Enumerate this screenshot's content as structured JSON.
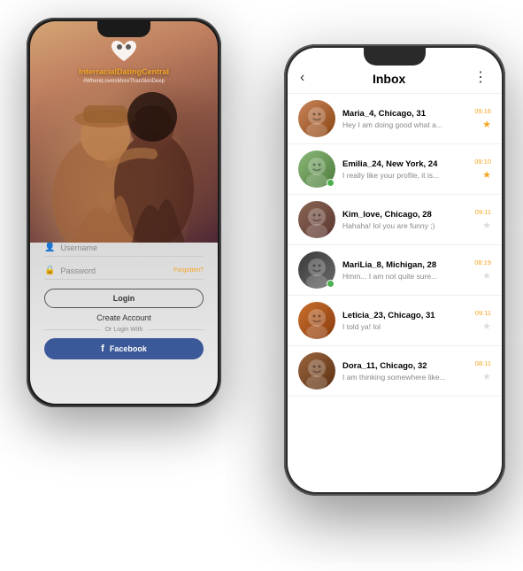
{
  "brand": {
    "logo_label": "InterracialDatingCentral",
    "logo_part1": "Interracial",
    "logo_part2": "Dating",
    "logo_part3": "Central",
    "tagline": "#WhereLoveIsMoreThanSkinDeep"
  },
  "login_form": {
    "username_placeholder": "Username",
    "password_placeholder": "Password",
    "forgotten_label": "Forgotten?",
    "login_button": "Login",
    "create_account": "Create Account",
    "or_login_with": "Or Login With",
    "facebook_button": "Facebook"
  },
  "inbox": {
    "title": "Inbox",
    "back_icon": "‹",
    "menu_icon": "⋮",
    "messages": [
      {
        "name": "Maria_4, Chicago, 31",
        "preview": "Hey I am doing good what a...",
        "time": "09:16",
        "starred": true,
        "online": false,
        "avatar_class": "av1"
      },
      {
        "name": "Emilia_24, New York, 24",
        "preview": "I really like your profile, it is...",
        "time": "09:10",
        "starred": true,
        "online": true,
        "avatar_class": "av2"
      },
      {
        "name": "Kim_love, Chicago, 28",
        "preview": "Hahaha! lol you are funny ;)",
        "time": "09:11",
        "starred": false,
        "online": false,
        "avatar_class": "av3"
      },
      {
        "name": "MariLia_8, Michigan, 28",
        "preview": "Hmm... I am not quite sure...",
        "time": "08:19",
        "starred": false,
        "online": true,
        "avatar_class": "av4"
      },
      {
        "name": "Leticia_23, Chicago, 31",
        "preview": "I told ya! lol",
        "time": "09:11",
        "starred": false,
        "online": false,
        "avatar_class": "av5"
      },
      {
        "name": "Dora_11, Chicago, 32",
        "preview": "I am thinking somewhere like...",
        "time": "08:11",
        "starred": false,
        "online": false,
        "avatar_class": "av6"
      }
    ]
  }
}
